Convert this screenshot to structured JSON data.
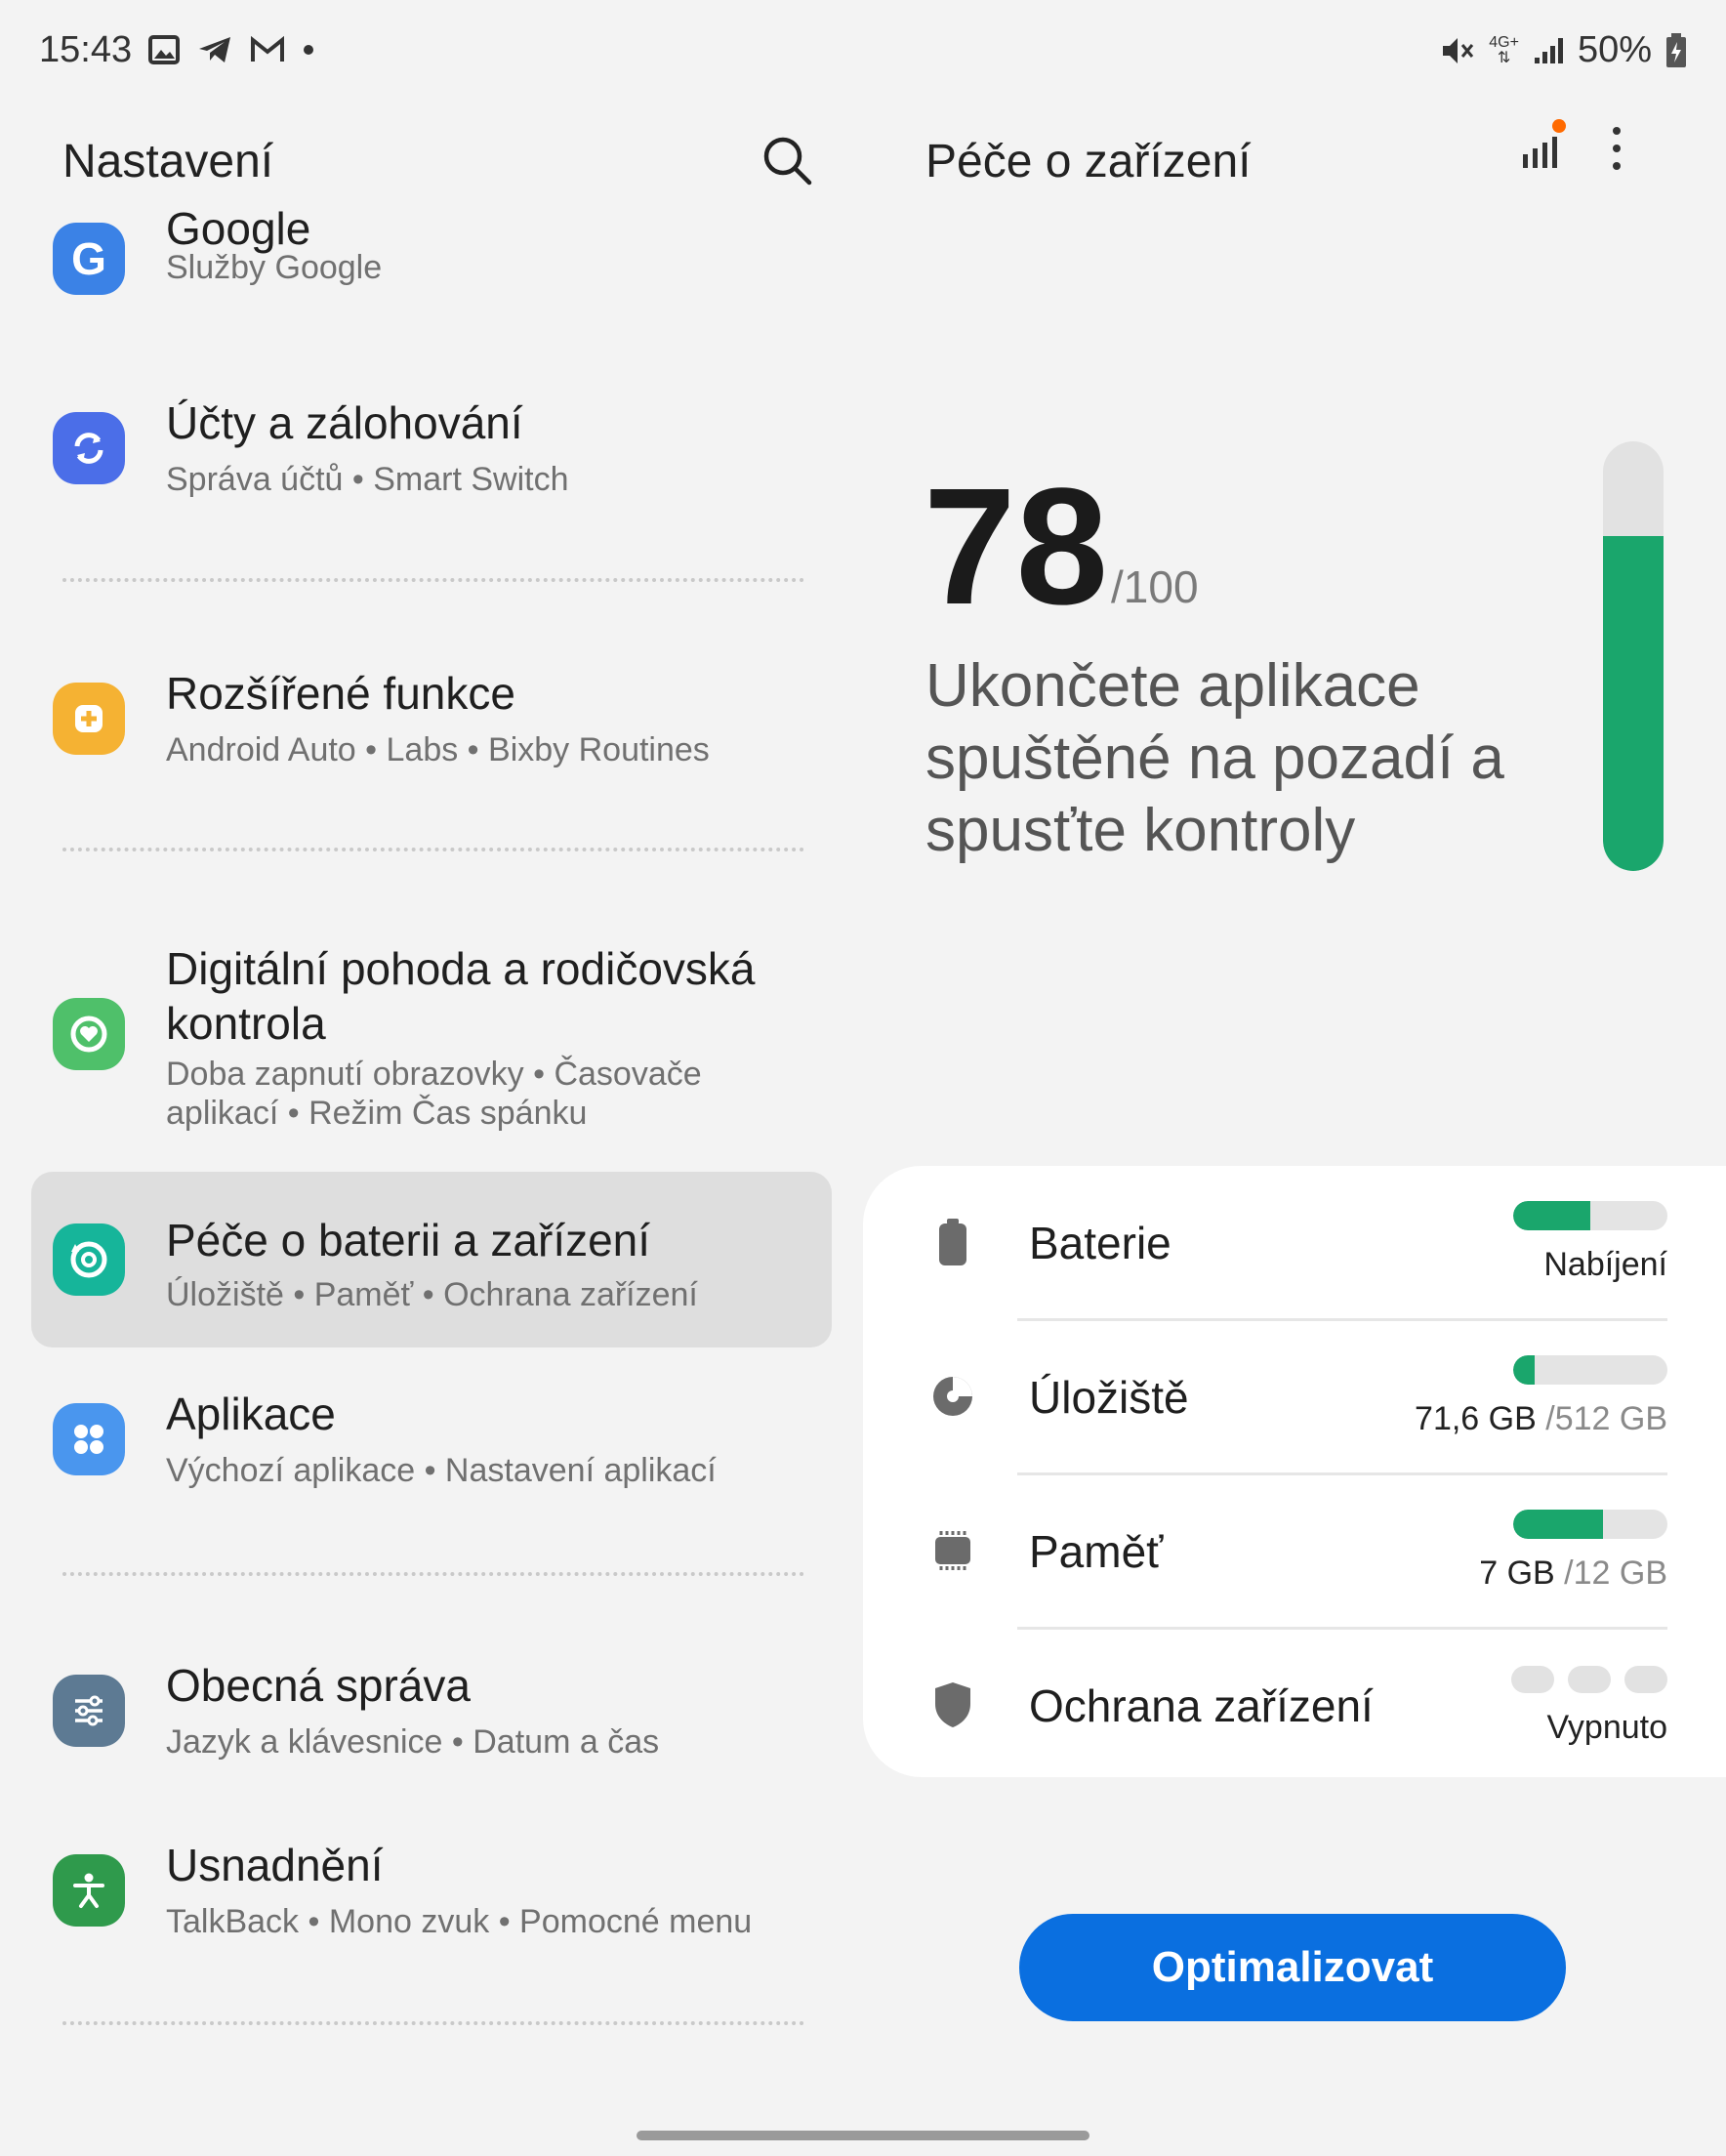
{
  "status_bar": {
    "time": "15:43",
    "battery": "50%",
    "network": "4G+"
  },
  "left": {
    "title": "Nastavení",
    "items": [
      {
        "title": "Google",
        "sub": "Služby Google",
        "color": "#3b82e6"
      },
      {
        "title": "Účty a zálohování",
        "sub": "Správa účtů  •  Smart Switch",
        "color": "#4b6ee8"
      },
      {
        "title": "Rozšířené funkce",
        "sub": "Android Auto  •  Labs  •  Bixby Routines",
        "color": "#f5b233"
      },
      {
        "title": "Digitální pohoda a rodičovská kontrola",
        "sub": "Doba zapnutí obrazovky  •  Časovače aplikací  •  Režim Čas spánku",
        "color": "#4fc06a"
      },
      {
        "title": "Péče o baterii a zařízení",
        "sub": "Úložiště  •  Paměť  •  Ochrana zařízení",
        "color": "#16b59a"
      },
      {
        "title": "Aplikace",
        "sub": "Výchozí aplikace  •  Nastavení aplikací",
        "color": "#4a96ee"
      },
      {
        "title": "Obecná správa",
        "sub": "Jazyk a klávesnice  •  Datum a čas",
        "color": "#5d7a93"
      },
      {
        "title": "Usnadnění",
        "sub": "TalkBack  •  Mono zvuk  •  Pomocné menu",
        "color": "#2f9a4c"
      }
    ]
  },
  "right": {
    "title": "Péče o zařízení",
    "score": "78",
    "score_max": "/100",
    "score_fraction": 0.78,
    "message": "Ukončete aplikace spuštěné na pozadí a spusťte kontroly",
    "rows": [
      {
        "label": "Baterie",
        "value": "Nabíjení",
        "value_muted": "",
        "fill": 0.5
      },
      {
        "label": "Úložiště",
        "value": "71,6 GB",
        "value_muted": "/512 GB",
        "fill": 0.14
      },
      {
        "label": "Paměť",
        "value": "7 GB",
        "value_muted": "/12 GB",
        "fill": 0.58
      },
      {
        "label": "Ochrana zařízení",
        "value": "Vypnuto",
        "value_muted": ""
      }
    ],
    "button": "Optimalizovat"
  },
  "colors": {
    "accent": "#0a6fe0",
    "green": "#1aa66c",
    "badge": "#ff6a00"
  }
}
